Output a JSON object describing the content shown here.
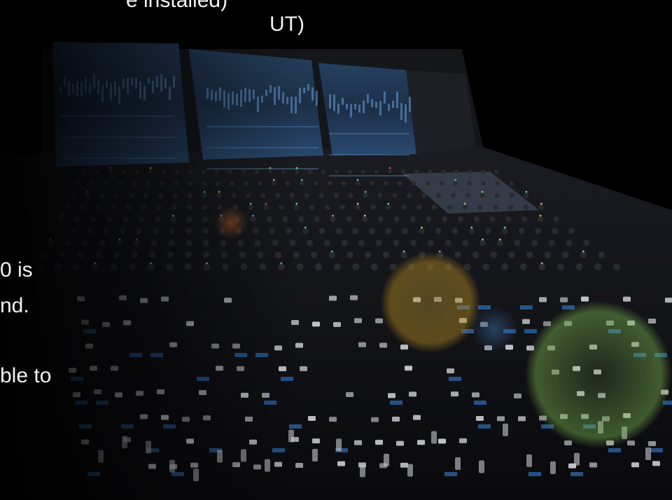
{
  "captions": [
    "e installed)",
    "UT)",
    "0 is",
    "nd.",
    "ble to"
  ],
  "photo": {
    "subject": "digital mixing console",
    "screen_glow": "#5b8fd6",
    "flare_colors": [
      "#c9a23a",
      "#6fa84a",
      "#3a6fa8",
      "#c0622a"
    ]
  }
}
